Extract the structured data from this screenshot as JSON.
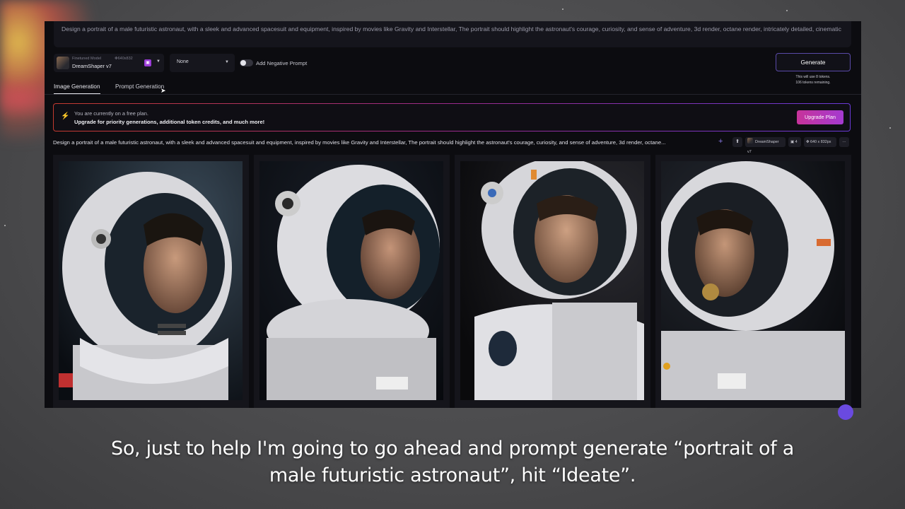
{
  "prompt_box": {
    "text": "Design a portrait of a male futuristic astronaut, with a sleek and advanced spacesuit and equipment, inspired by movies like Gravity and Interstellar, The portrait should highlight the astronaut's courage, curiosity, and sense of adventure, 3d render, octane render, intricately detailed, cinematic"
  },
  "toolbar": {
    "model_label": "Finetuned Model",
    "model_dims": "640x832",
    "model_name": "DreamShaper v7",
    "style_value": "None",
    "negative_prompt_label": "Add Negative Prompt",
    "negative_prompt_enabled": false,
    "generate_label": "Generate",
    "token_note_1": "This will use 8 tokens.",
    "token_note_2": "106 tokens remaining."
  },
  "tabs": [
    {
      "label": "Image Generation",
      "active": true
    },
    {
      "label": "Prompt Generation",
      "active": false
    }
  ],
  "banner": {
    "line1": "You are currently on a free plan.",
    "line2": "Upgrade for priority generations, additional token credits, and much more!",
    "button": "Upgrade Plan"
  },
  "generation": {
    "prompt": "Design a portrait of a male futuristic astronaut, with a sleek and advanced spacesuit and equipment, inspired by movies like Gravity and Interstellar, The portrait should highlight the astronaut's courage, curiosity, and sense of adventure, 3d render, octane...",
    "model_chip": "DreamShaper v7",
    "count_chip": "4",
    "size_chip": "640 x 832px",
    "images": [
      {
        "alt": "astronaut portrait 1"
      },
      {
        "alt": "astronaut portrait 2"
      },
      {
        "alt": "astronaut portrait 3"
      },
      {
        "alt": "astronaut portrait 4"
      }
    ]
  },
  "caption": {
    "line1": "So, just to help I'm going to go ahead and prompt generate “portrait of a",
    "line2": "male futuristic astronaut”, hit “Ideate”."
  },
  "colors": {
    "accent": "#6a3ad8",
    "upgrade": "#c7339a",
    "bolt": "#f2c230"
  }
}
